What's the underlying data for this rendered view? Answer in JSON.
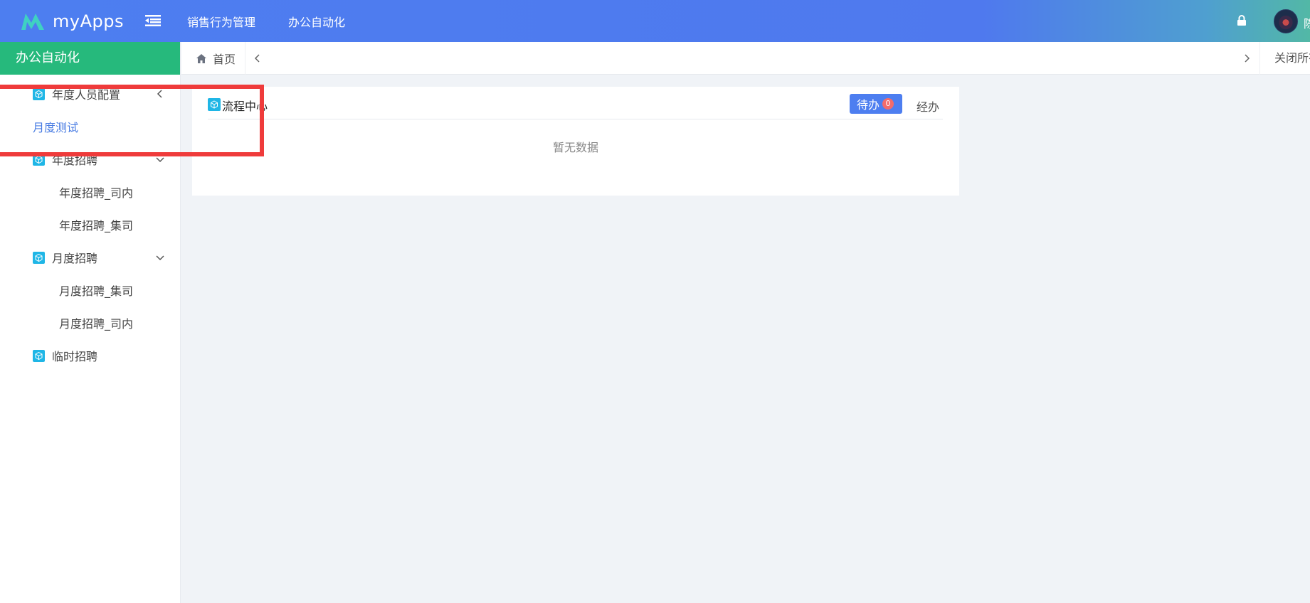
{
  "header": {
    "app_name": "myApps",
    "nav": [
      "销售行为管理",
      "办公自动化"
    ],
    "user_name": "陈"
  },
  "sidebar": {
    "title": "办公自动化",
    "items": [
      {
        "label": "年度人员配置",
        "level": 1,
        "icon": "cube-icon",
        "chevron": "chevron-left-icon"
      },
      {
        "label": "月度测试",
        "level": 1,
        "icon": "",
        "active": true
      },
      {
        "label": "年度招聘",
        "level": 1,
        "icon": "cube-icon",
        "chevron": "chevron-down-icon"
      },
      {
        "label": "年度招聘_司内",
        "level": 2
      },
      {
        "label": "年度招聘_集司",
        "level": 2
      },
      {
        "label": "月度招聘",
        "level": 1,
        "icon": "cube-icon",
        "chevron": "chevron-down-icon"
      },
      {
        "label": "月度招聘_集司",
        "level": 2
      },
      {
        "label": "月度招聘_司内",
        "level": 2
      },
      {
        "label": "临时招聘",
        "level": 1,
        "icon": "cube-icon"
      }
    ]
  },
  "tabs": {
    "home_label": "首页",
    "close_all_label": "关闭所有"
  },
  "card": {
    "title": "流程中心",
    "tab_todo_label": "待办",
    "tab_todo_count": "0",
    "tab_done_label": "经办",
    "empty_text": "暂无数据"
  },
  "colors": {
    "header_blue": "#4d7ef0",
    "sidebar_green": "#26b97c",
    "highlight_red": "#ef3b3b",
    "icon_cyan": "#1fb6e6"
  }
}
